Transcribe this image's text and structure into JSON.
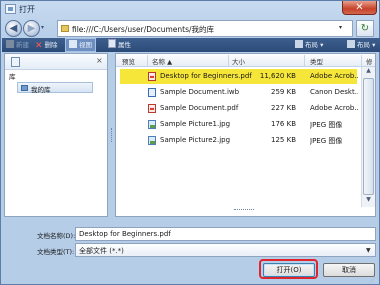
{
  "window": {
    "title": "打开",
    "close_label": "✕"
  },
  "nav": {
    "back_glyph": "◀",
    "forward_glyph": "▶",
    "dropdown_glyph": "▾",
    "refresh_glyph": "↻"
  },
  "address": {
    "path": "file:///C:/Users/user/Documents/我的库",
    "dropdown_glyph": "▾"
  },
  "toolbar": {
    "new_folder": "新建",
    "delete": "删除",
    "view": "视图",
    "properties": "属性",
    "layout": "布局",
    "layout2": "布局"
  },
  "left_pane": {
    "header_label": "库",
    "close_glyph": "×",
    "item_label": "我的库"
  },
  "file_list": {
    "columns": [
      "预览",
      "名称 ▲",
      "大小",
      "类型",
      "修"
    ],
    "rows": [
      {
        "name": "Desktop for Beginners.pdf",
        "size": "11,620 KB",
        "type": "Adobe Acrob...",
        "extra": "2",
        "icon": "pdf-file-icon",
        "selected": true
      },
      {
        "name": "Sample Document.iwb",
        "size": "259 KB",
        "type": "Canon Deskt...",
        "extra": "2",
        "icon": "iwb-file-icon",
        "selected": false
      },
      {
        "name": "Sample Document.pdf",
        "size": "227 KB",
        "type": "Adobe Acrob...",
        "extra": "2",
        "icon": "pdf-file-icon",
        "selected": false
      },
      {
        "name": "Sample Picture1.jpg",
        "size": "176 KB",
        "type": "JPEG 图像",
        "extra": "2",
        "icon": "jpg-file-icon",
        "selected": false
      },
      {
        "name": "Sample Picture2.jpg",
        "size": "125 KB",
        "type": "JPEG 图像",
        "extra": "2",
        "icon": "jpg-file-icon",
        "selected": false
      }
    ]
  },
  "bottom": {
    "filename_label": "文档名称(D):",
    "filename_value": "Desktop for Beginners.pdf",
    "filetype_label": "文档类型(T):",
    "filetype_value": "全部文件 (*.*)",
    "open_label": "打开(O)",
    "cancel_label": "取消"
  },
  "colors": {
    "selected_row": "#f7e63a",
    "toolbar_bg": "#2b4a78",
    "highlight_ring": "#e0252e"
  }
}
